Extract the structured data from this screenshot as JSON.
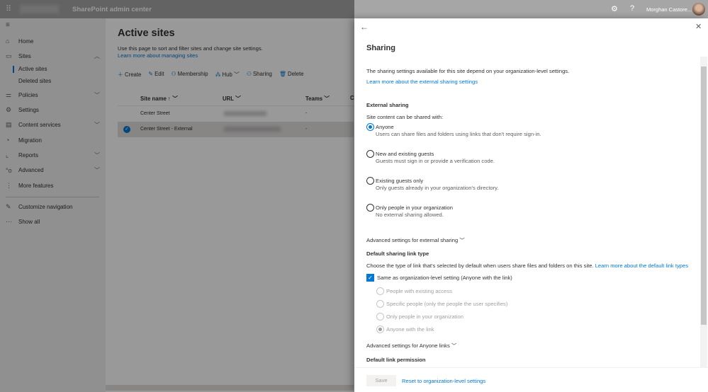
{
  "header": {
    "app_title": "SharePoint admin center",
    "user_name": "Morghan Castore...",
    "icons": [
      "waffle-icon",
      "gear-icon",
      "help-icon",
      "avatar"
    ]
  },
  "nav": {
    "items": [
      {
        "label": "Home",
        "icon": "home-icon"
      },
      {
        "label": "Sites",
        "icon": "sites-icon",
        "expanded": true,
        "children": [
          {
            "label": "Active sites",
            "active": true
          },
          {
            "label": "Deleted sites"
          }
        ]
      },
      {
        "label": "Policies",
        "icon": "policies-icon"
      },
      {
        "label": "Settings",
        "icon": "gear-icon"
      },
      {
        "label": "Content services",
        "icon": "content-icon"
      },
      {
        "label": "Migration",
        "icon": "migration-icon"
      },
      {
        "label": "Reports",
        "icon": "reports-icon"
      },
      {
        "label": "Advanced",
        "icon": "advanced-icon"
      },
      {
        "label": "More features",
        "icon": "more-icon"
      }
    ],
    "customize": "Customize navigation",
    "show_all": "Show all"
  },
  "main": {
    "title": "Active sites",
    "description": "Use this page to sort and filter sites and change site settings.",
    "learn_link": "Learn more about managing sites",
    "toolbar": [
      "Create",
      "Edit",
      "Membership",
      "Hub",
      "Sharing",
      "Delete"
    ],
    "columns": [
      "Site name",
      "URL",
      "Teams",
      "C"
    ],
    "rows": [
      {
        "name": "Center Street",
        "teams": "-",
        "selected": false
      },
      {
        "name": "Center Street - External",
        "teams": "-",
        "selected": true
      }
    ]
  },
  "panel": {
    "title": "Sharing",
    "intro": "The sharing settings available for this site depend on your organization-level settings.",
    "intro_link": "Learn more about the external sharing settings",
    "external_heading": "External sharing",
    "external_label": "Site content can be shared with:",
    "options": [
      {
        "label": "Anyone",
        "desc": "Users can share files and folders using links that don't require sign-in.",
        "selected": true
      },
      {
        "label": "New and existing guests",
        "desc": "Guests must sign in or provide a verification code.",
        "selected": false
      },
      {
        "label": "Existing guests only",
        "desc": "Only guests already in your organization's directory.",
        "selected": false
      },
      {
        "label": "Only people in your organization",
        "desc": "No external sharing allowed.",
        "selected": false
      }
    ],
    "advanced_external": "Advanced settings for external sharing",
    "link_type_heading": "Default sharing link type",
    "link_type_desc": "Choose the type of link that's selected by default when users share files and folders on this site.",
    "link_type_link": "Learn more about the default link types",
    "same_as_org": "Same as organization-level setting (Anyone with the link)",
    "same_as_org_checked": true,
    "link_options": [
      {
        "label": "People with existing access",
        "selected": false
      },
      {
        "label": "Specific people (only the people the user specifies)",
        "selected": false
      },
      {
        "label": "Only people in your organization",
        "selected": false
      },
      {
        "label": "Anyone with the link",
        "selected": true
      }
    ],
    "advanced_anyone": "Advanced settings for Anyone links",
    "permission_heading": "Default link permission",
    "save": "Save",
    "reset": "Reset to organization-level settings"
  }
}
